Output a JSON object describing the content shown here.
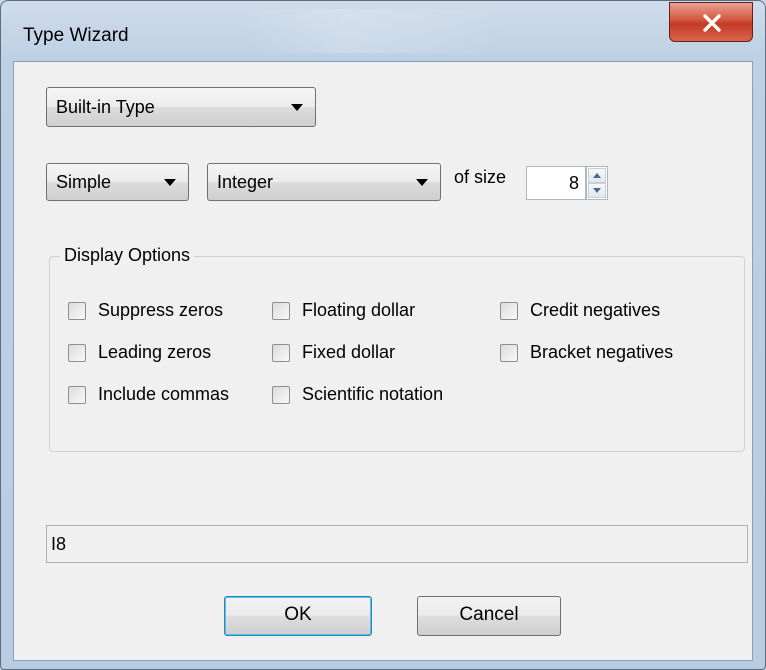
{
  "window": {
    "title": "Type Wizard",
    "close_glyph": "X"
  },
  "category_select": {
    "value": "Built-in Type"
  },
  "kind_select": {
    "value": "Simple"
  },
  "type_select": {
    "value": "Integer"
  },
  "size": {
    "label": "of size",
    "value": "8"
  },
  "display_options": {
    "label": "Display Options",
    "checkboxes": [
      {
        "label": "Suppress zeros",
        "checked": false
      },
      {
        "label": "Leading zeros",
        "checked": false
      },
      {
        "label": "Include commas",
        "checked": false
      },
      {
        "label": "Floating dollar",
        "checked": false
      },
      {
        "label": "Fixed dollar",
        "checked": false
      },
      {
        "label": "Scientific notation",
        "checked": false
      },
      {
        "label": "Credit negatives",
        "checked": false
      },
      {
        "label": "Bracket negatives",
        "checked": false
      }
    ]
  },
  "result": {
    "value": "I8"
  },
  "buttons": {
    "ok": "OK",
    "cancel": "Cancel"
  }
}
